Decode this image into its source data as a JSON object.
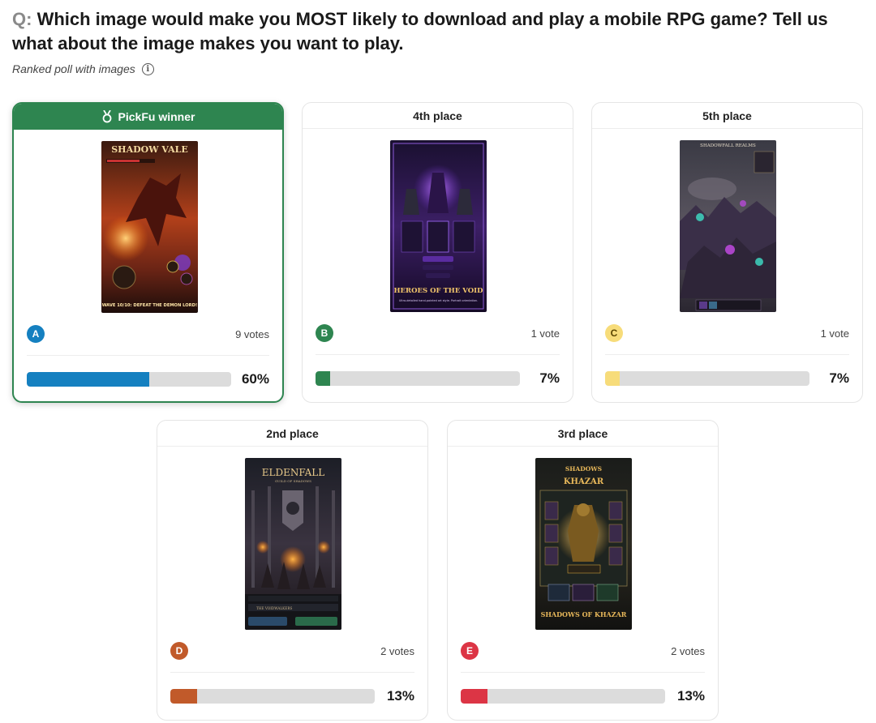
{
  "question": {
    "prefix": "Q:",
    "text": "Which image would make you MOST likely to download and play a mobile RPG game? Tell us what about the image makes you want to play."
  },
  "subtitle": "Ranked poll with images",
  "colors": {
    "winner_green": "#2e8550",
    "A": "#1580c0",
    "B": "#2e8550",
    "C": "#f7dc7a",
    "D": "#c15a2a",
    "E": "#dc3545"
  },
  "options": [
    {
      "id": "A",
      "header": "PickFu winner",
      "letter": "A",
      "votes": "9 votes",
      "percent": "60%",
      "fraction": 0.6,
      "image_title": "SHADOW VALE",
      "image_caption": "WAVE 10/10: DEFEAT THE DEMON LORD!"
    },
    {
      "id": "B",
      "header": "4th place",
      "letter": "B",
      "votes": "1 vote",
      "percent": "7%",
      "fraction": 0.07,
      "image_title": "HEROES OF THE VOID",
      "image_caption": "Ultra-detailed hand-painted art style. Portrait orientation."
    },
    {
      "id": "C",
      "header": "5th place",
      "letter": "C",
      "votes": "1 vote",
      "percent": "7%",
      "fraction": 0.07,
      "image_title": "SHADOWFALL REALMS",
      "image_caption": ""
    },
    {
      "id": "D",
      "header": "2nd place",
      "letter": "D",
      "votes": "2 votes",
      "percent": "13%",
      "fraction": 0.13,
      "image_title": "ELDENFALL",
      "image_subtitle": "GUILD OF SHADOWS",
      "image_caption": "THE VOIDWALKERS"
    },
    {
      "id": "E",
      "header": "3rd place",
      "letter": "E",
      "votes": "2 votes",
      "percent": "13%",
      "fraction": 0.13,
      "image_title": "SHADOWS OF KHAZAR",
      "image_caption": "SHADOWS OF KHAZAR"
    }
  ]
}
